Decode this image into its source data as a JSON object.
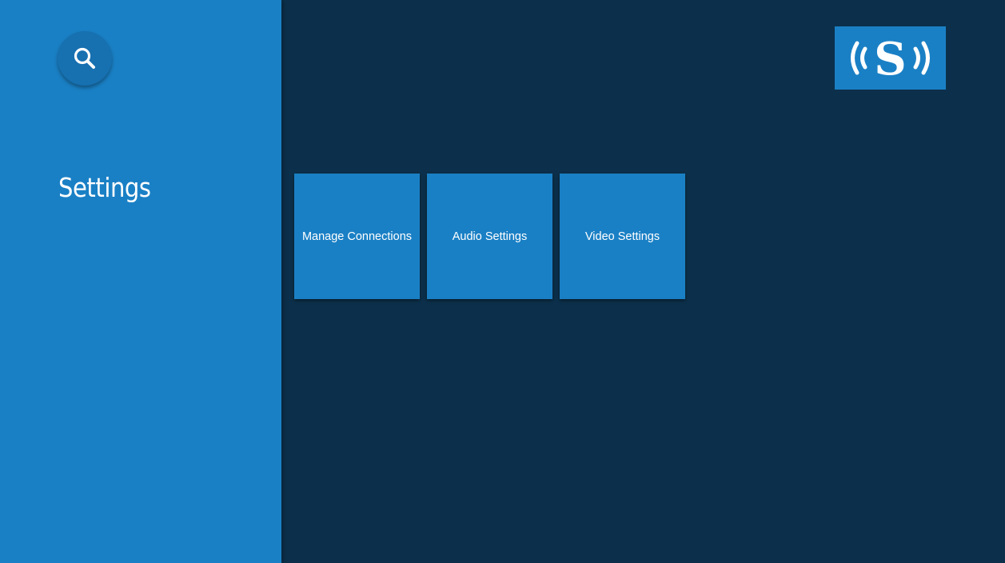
{
  "sidebar": {
    "search_icon": "search-icon",
    "title": "Settings"
  },
  "brand": {
    "logo_letter": "S"
  },
  "tiles": [
    {
      "label": "Manage Connections"
    },
    {
      "label": "Audio Settings"
    },
    {
      "label": "Video Settings"
    }
  ],
  "colors": {
    "background": "#0c304b",
    "accent": "#1a80c5",
    "search_orb": "#1770b0",
    "text": "#ffffff"
  }
}
